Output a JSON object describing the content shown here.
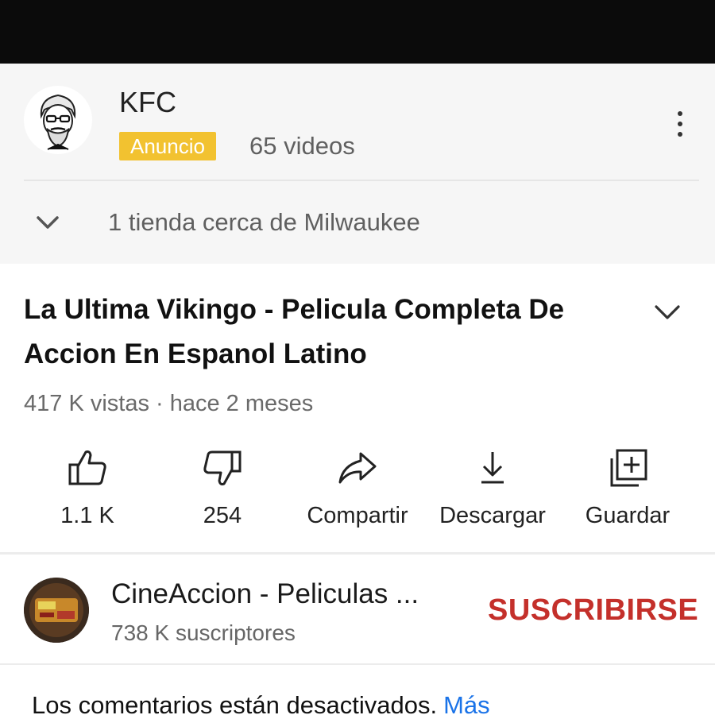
{
  "ad": {
    "name": "KFC",
    "badge": "Anuncio",
    "video_count": "65 videos",
    "store_text": "1 tienda cerca de Milwaukee"
  },
  "video": {
    "title": "La Ultima Vikingo - Pelicula Completa De Accion En Espanol Latino",
    "meta": "417 K vistas · hace 2 meses"
  },
  "actions": {
    "like": "1.1 K",
    "dislike": "254",
    "share": "Compartir",
    "download": "Descargar",
    "save": "Guardar"
  },
  "channel": {
    "name": "CineAccion - Peliculas ...",
    "subscribers": "738 K suscriptores",
    "subscribe_label": "SUSCRIBIRSE"
  },
  "comments": {
    "text": "Los comentarios están desactivados.",
    "more_link": "Más"
  },
  "colors": {
    "badge": "#f2c230",
    "subscribe": "#c4302b",
    "link": "#1a73e8"
  },
  "icons": [
    "kfc-logo",
    "more-vert-icon",
    "chevron-down-icon",
    "thumb-up-icon",
    "thumb-down-icon",
    "share-icon",
    "download-icon",
    "playlist-add-icon",
    "channel-avatar"
  ]
}
